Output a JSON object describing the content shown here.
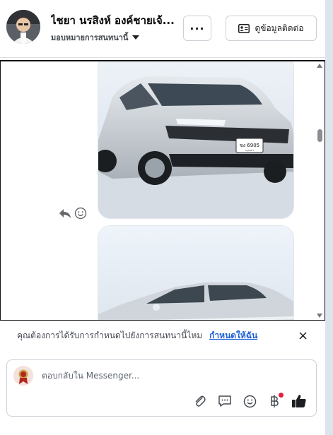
{
  "header": {
    "name": "ไชยา นรสิงห์ องค์ชายเจ้...",
    "assign_label": "มอบหมายการสนทนานี้",
    "more_label": "···",
    "contact_label": "ดูข้อมูลติดต่อ"
  },
  "messages": {
    "photo1_plate": "ขง 6905",
    "photo1_plate_sub": "กรุงเทพ ฯ"
  },
  "suggestion": {
    "text": "คุณต้องการได้รับการกำหนดไปยังการสนทนานี้ไหม",
    "link": "กำหนดให้ฉัน",
    "close": "×"
  },
  "composer": {
    "placeholder": "ตอบกลับใน Messenger..."
  },
  "icons": [
    "avatar",
    "more-icon",
    "contact-card-icon",
    "reply-icon",
    "emoji-icon",
    "close-icon",
    "attach-icon",
    "saved-reply-icon",
    "baht-icon",
    "like-icon"
  ],
  "colors": {
    "link": "#1b5fd6",
    "notification_dot": "#e41e3f",
    "car": "#d5dadf"
  }
}
